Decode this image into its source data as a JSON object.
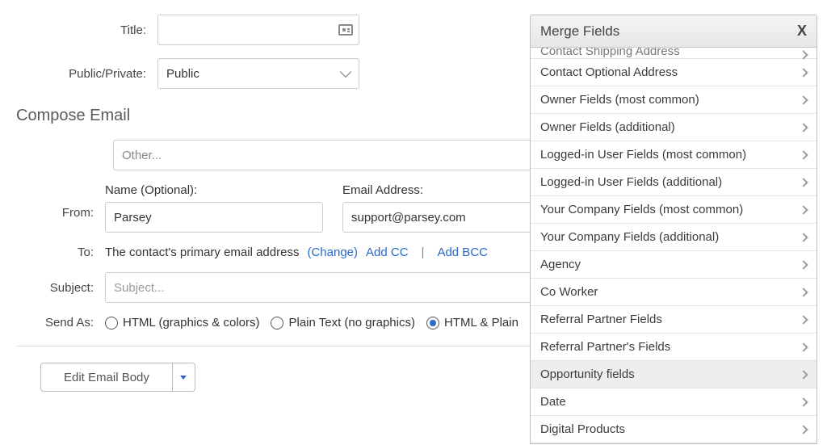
{
  "form": {
    "title_label": "Title:",
    "title_value": "",
    "public_label": "Public/Private:",
    "public_value": "Public",
    "compose_heading": "Compose Email",
    "other_value": "Other...",
    "from_label": "From:",
    "name_label": "Name (Optional):",
    "name_value": "Parsey",
    "email_label": "Email Address:",
    "email_value": "support@parsey.com",
    "to_label": "To:",
    "to_text": "The contact's primary email address",
    "change_link": "(Change)",
    "add_cc": "Add CC",
    "add_bcc": "Add BCC",
    "subject_label": "Subject:",
    "subject_placeholder": "Subject...",
    "sendas_label": "Send As:",
    "sendas_options": {
      "html": "HTML (graphics & colors)",
      "plain": "Plain Text (no graphics)",
      "both": "HTML & Plain"
    },
    "sendas_selected": "both",
    "edit_body_label": "Edit Email Body"
  },
  "merge_panel": {
    "title": "Merge Fields",
    "close": "X",
    "items": [
      {
        "label": "Contact Shipping Address",
        "clipped": true
      },
      {
        "label": "Contact Optional Address"
      },
      {
        "label": "Owner Fields (most common)"
      },
      {
        "label": "Owner Fields (additional)"
      },
      {
        "label": "Logged-in User Fields (most common)"
      },
      {
        "label": "Logged-in User Fields (additional)"
      },
      {
        "label": "Your Company Fields (most common)"
      },
      {
        "label": "Your Company Fields (additional)"
      },
      {
        "label": "Agency"
      },
      {
        "label": "Co Worker"
      },
      {
        "label": "Referral Partner Fields"
      },
      {
        "label": "Referral Partner's Fields"
      },
      {
        "label": "Opportunity fields",
        "highlight": true
      },
      {
        "label": "Date"
      },
      {
        "label": "Digital Products"
      }
    ]
  }
}
